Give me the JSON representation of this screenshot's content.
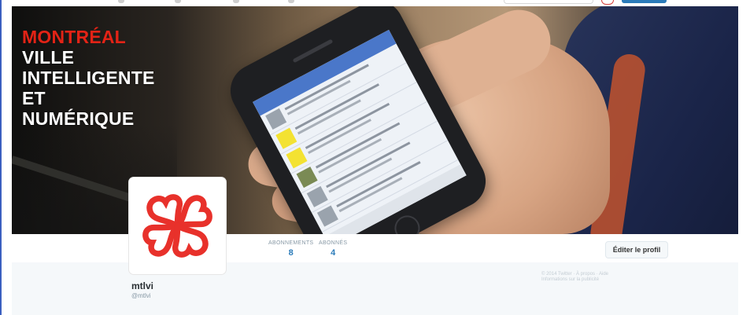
{
  "colors": {
    "accent_blue": "#2b7bb9",
    "montreal_red": "#e32316",
    "avatar_logo_red": "#e8312b"
  },
  "banner": {
    "headline_red": "MONTRÉAL",
    "headline_white": [
      "VILLE",
      "INTELLIGENTE",
      "ET",
      "NUMÉRIQUE"
    ]
  },
  "stats": [
    {
      "label": "ABONNEMENTS",
      "value": "8"
    },
    {
      "label": "ABONNÉS",
      "value": "4"
    }
  ],
  "edit_profile_label": "Éditer le profil",
  "profile": {
    "name": "mtlvi",
    "handle": "@mtlvi",
    "avatar_icon": "montreal-flower-logo-icon"
  },
  "footer": {
    "line1": "© 2014 Twitter · À propos · Aide",
    "line2": "Informations sur la publicité"
  }
}
